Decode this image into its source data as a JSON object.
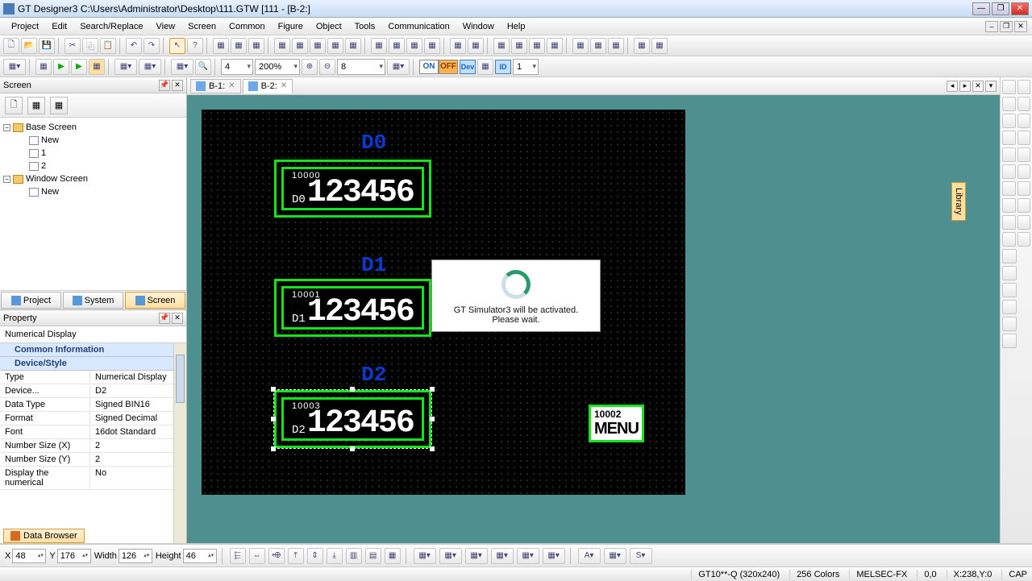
{
  "title": "GT Designer3 C:\\Users\\Administrator\\Desktop\\111.GTW [111 - [B-2:]",
  "menu": [
    "Project",
    "Edit",
    "Search/Replace",
    "View",
    "Screen",
    "Common",
    "Figure",
    "Object",
    "Tools",
    "Communication",
    "Window",
    "Help"
  ],
  "toolbar2": {
    "combo1": "4",
    "zoom": "200%",
    "combo2": "8",
    "on": "ON",
    "off": "OFF",
    "dev": "Dev",
    "id": "ID",
    "idval": "1"
  },
  "screen_panel_title": "Screen",
  "tree": {
    "base": "Base Screen",
    "base_items": [
      "New",
      "1",
      "2"
    ],
    "window": "Window Screen",
    "window_items": [
      "New"
    ]
  },
  "left_tabs": [
    "Project",
    "System",
    "Screen"
  ],
  "property_title": "Property",
  "property_type": "Numerical Display",
  "prop_groups": [
    "Common Information",
    "Device/Style"
  ],
  "props": [
    {
      "k": "Type",
      "v": "Numerical Display"
    },
    {
      "k": "Device...",
      "v": "D2"
    },
    {
      "k": "Data Type",
      "v": "Signed BIN16"
    },
    {
      "k": "Format",
      "v": "Signed Decimal"
    },
    {
      "k": "Font",
      "v": "16dot Standard"
    },
    {
      "k": "Number Size (X)",
      "v": "2"
    },
    {
      "k": "Number Size (Y)",
      "v": "2"
    },
    {
      "k": "Display the numerical",
      "v": "No"
    }
  ],
  "data_browser": "Data Browser",
  "doc_tabs": [
    {
      "label": "B-1:",
      "active": false
    },
    {
      "label": "B-2:",
      "active": true
    }
  ],
  "canvas": {
    "labels": {
      "d0": "D0",
      "d1": "D1",
      "d2": "D2"
    },
    "box0": {
      "id": "10000",
      "dev": "D0",
      "val": "123456"
    },
    "box1": {
      "id": "10001",
      "dev": "D1",
      "val": "123456"
    },
    "box2": {
      "id": "10003",
      "dev": "D2",
      "val": "123456"
    },
    "menu": {
      "id": "10002",
      "label": "MENU"
    }
  },
  "modal": {
    "line1": "GT Simulator3 will be activated.",
    "line2": "Please wait."
  },
  "library_tab": "Library",
  "bottom": {
    "x_label": "X",
    "x": "48",
    "y_label": "Y",
    "y": "176",
    "w_label": "Width",
    "w": "126",
    "h_label": "Height",
    "h": "46"
  },
  "status": {
    "model": "GT10**-Q (320x240)",
    "colors": "256 Colors",
    "plc": "MELSEC-FX",
    "off": "0,0",
    "xy": "X:238,Y:0",
    "cap": "CAP"
  }
}
